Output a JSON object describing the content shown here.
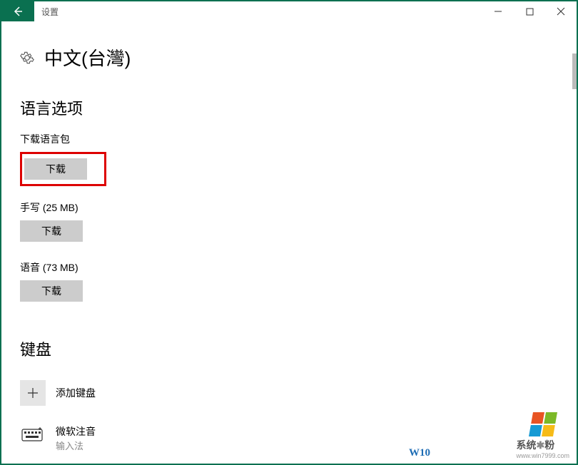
{
  "titlebar": {
    "title": "设置"
  },
  "page": {
    "heading": "中文(台灣)"
  },
  "language_options": {
    "heading": "语言选项",
    "language_pack": {
      "label": "下载语言包",
      "button": "下载"
    },
    "handwriting": {
      "label": "手写 (25 MB)",
      "button": "下载"
    },
    "speech": {
      "label": "语音 (73 MB)",
      "button": "下载"
    }
  },
  "keyboard": {
    "heading": "键盘",
    "add_label": "添加键盘",
    "ime": {
      "name": "微软注音",
      "sub": "输入法"
    }
  },
  "watermark": {
    "w": "W10",
    "brand": "系统",
    "brand2": "粉",
    "url": "www.win7999.com"
  }
}
